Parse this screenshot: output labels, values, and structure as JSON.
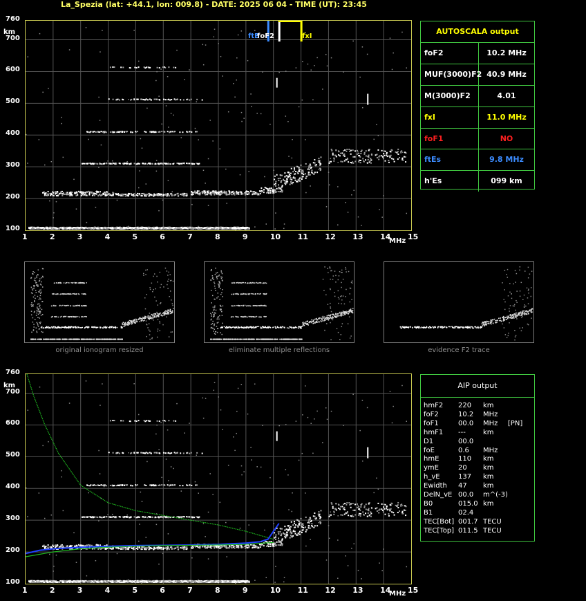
{
  "header": "La_Spezia (lat: +44.1, lon: 009.8) - DATE: 2025 06 04 - TIME (UT): 23:45",
  "axes": {
    "y_unit": "km",
    "x_unit": "MHz",
    "y_ticks": [
      "760",
      "700",
      "600",
      "500",
      "400",
      "300",
      "200",
      "100"
    ],
    "x_ticks": [
      "1",
      "2",
      "3",
      "4",
      "5",
      "6",
      "7",
      "8",
      "9",
      "10",
      "11",
      "12",
      "13",
      "14",
      "15"
    ]
  },
  "markers": {
    "ftEs": "ftE",
    "foF2": "foF2",
    "fxI": "fxI"
  },
  "autoscala": {
    "title": "AUTOSCALA output",
    "rows": [
      {
        "key": "foF2",
        "value": "10.2 MHz",
        "key_color": "#ffffff",
        "value_color": "#ffffff"
      },
      {
        "key": "MUF(3000)F2",
        "value": "40.9 MHz",
        "key_color": "#ffffff",
        "value_color": "#ffffff"
      },
      {
        "key": "M(3000)F2",
        "value": "4.01",
        "key_color": "#ffffff",
        "value_color": "#ffffff"
      },
      {
        "key": "fxI",
        "value": "11.0 MHz",
        "key_color": "#ffff00",
        "value_color": "#ffff00"
      },
      {
        "key": "foF1",
        "value": "NO",
        "key_color": "#ff2020",
        "value_color": "#ff2020"
      },
      {
        "key": "ftEs",
        "value": "9.8 MHz",
        "key_color": "#3c8cff",
        "value_color": "#3c8cff"
      },
      {
        "key": "h'Es",
        "value": "099    km",
        "key_color": "#ffffff",
        "value_color": "#ffffff"
      }
    ]
  },
  "thumbs": {
    "captions": [
      "original ionogram resized",
      "eliminate multiple reflections",
      "evidence F2 trace"
    ]
  },
  "aip": {
    "title": "AIP output",
    "rows": [
      [
        "hmF2",
        "220",
        "km",
        ""
      ],
      [
        "foF2",
        "10.2",
        "MHz",
        ""
      ],
      [
        "foF1",
        "00.0",
        "MHz",
        "[PN]"
      ],
      [
        "hmF1",
        "---",
        "km",
        ""
      ],
      [
        "D1",
        "00.0",
        "",
        ""
      ],
      [
        "foE",
        "0.6",
        "MHz",
        ""
      ],
      [
        "hmE",
        "110",
        "km",
        ""
      ],
      [
        "ymE",
        "20",
        "km",
        ""
      ],
      [
        "h_vE",
        "137",
        "km",
        ""
      ],
      [
        "Ewidth",
        "47",
        "km",
        ""
      ],
      [
        "DelN_vE",
        "00.0",
        "m^(-3)",
        ""
      ],
      [
        "B0",
        "015.0",
        "km",
        ""
      ],
      [
        "B1",
        "02.4",
        "",
        ""
      ],
      [
        "TEC[Bot]",
        "001.7",
        "TECU",
        ""
      ],
      [
        "TEC[Top]",
        "011.5",
        "TECU",
        ""
      ]
    ]
  },
  "chart_data": [
    {
      "type": "scatter",
      "name_hint": "main ionogram",
      "xlim": [
        1,
        15
      ],
      "ylim": [
        100,
        760
      ],
      "grid": true,
      "traces": [
        {
          "label": "E/Es",
          "points": [
            [
              1.2,
              110
            ],
            [
              3,
              110
            ],
            [
              5,
              110
            ],
            [
              7,
              110
            ],
            [
              9,
              110
            ]
          ]
        },
        {
          "label": "F",
          "points": [
            [
              1.7,
              215
            ],
            [
              3,
              220
            ],
            [
              5,
              210
            ],
            [
              7,
              220
            ],
            [
              9,
              225
            ],
            [
              10,
              240
            ],
            [
              11,
              300
            ],
            [
              12.5,
              335
            ],
            [
              14,
              340
            ]
          ]
        },
        {
          "label": "2nd hop",
          "points": [
            [
              3,
              310
            ],
            [
              5,
              310
            ],
            [
              7,
              315
            ]
          ]
        },
        {
          "label": "3rd hop",
          "points": [
            [
              3,
              410
            ],
            [
              5,
              410
            ],
            [
              7,
              415
            ]
          ]
        },
        {
          "label": "4th hop",
          "points": [
            [
              4,
              515
            ],
            [
              6,
              515
            ],
            [
              7.5,
              515
            ]
          ]
        },
        {
          "label": "5th hop",
          "points": [
            [
              4,
              615
            ],
            [
              6,
              615
            ]
          ]
        }
      ],
      "markers": [
        {
          "name": "ftEs",
          "x": 9.8
        },
        {
          "name": "foF2",
          "x": 10.2
        },
        {
          "name": "fxI",
          "x": 11.0
        }
      ]
    },
    {
      "type": "line",
      "name_hint": "AIP profile",
      "xlim": [
        1,
        15
      ],
      "ylim": [
        100,
        760
      ],
      "series": [
        {
          "color": "#20c020",
          "x": [
            1.05,
            1.3,
            1.7,
            2.2,
            3,
            4,
            5,
            6,
            7,
            8,
            9,
            10
          ],
          "y": [
            760,
            690,
            600,
            510,
            410,
            355,
            330,
            315,
            300,
            285,
            265,
            240
          ]
        },
        {
          "color": "#2040ff",
          "x": [
            1,
            1.5,
            2,
            3,
            4,
            5,
            6,
            7,
            8,
            9,
            9.5,
            9.8,
            10.2
          ],
          "y": [
            195,
            205,
            210,
            215,
            218,
            220,
            221,
            222,
            224,
            228,
            232,
            240,
            290
          ]
        },
        {
          "color": "#20c020",
          "x": [
            1,
            2,
            3,
            4,
            5,
            6,
            7,
            8,
            9,
            10
          ],
          "y": [
            185,
            200,
            210,
            215,
            218,
            220,
            221,
            222,
            224,
            230
          ]
        }
      ]
    }
  ]
}
